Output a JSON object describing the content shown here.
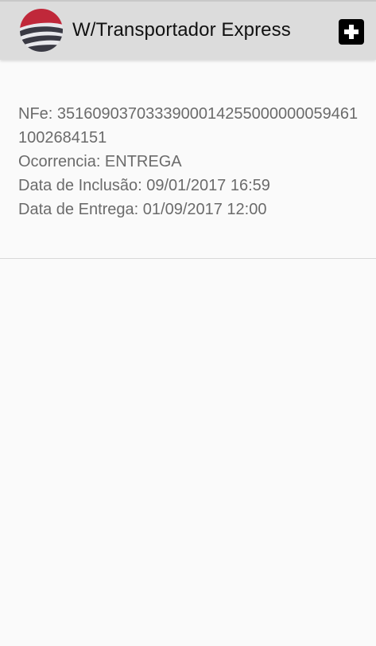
{
  "app_bar": {
    "title": "W/Transportador Express",
    "logo_icon": "globe-logo-icon",
    "add_icon": "plus-icon"
  },
  "colors": {
    "app_bar_bg": "#dcdcdc",
    "logo_red": "#c0283a",
    "logo_dark": "#3a3a44",
    "text_secondary": "#6b6b6b"
  },
  "delivery": {
    "nfe": "NFe: 35160903703339000142550000000594611002684151",
    "ocorrencia": "Ocorrencia: ENTREGA",
    "data_inclusao": "Data de Inclusão: 09/01/2017 16:59",
    "data_entrega": "Data de Entrega: 01/09/2017 12:00"
  }
}
